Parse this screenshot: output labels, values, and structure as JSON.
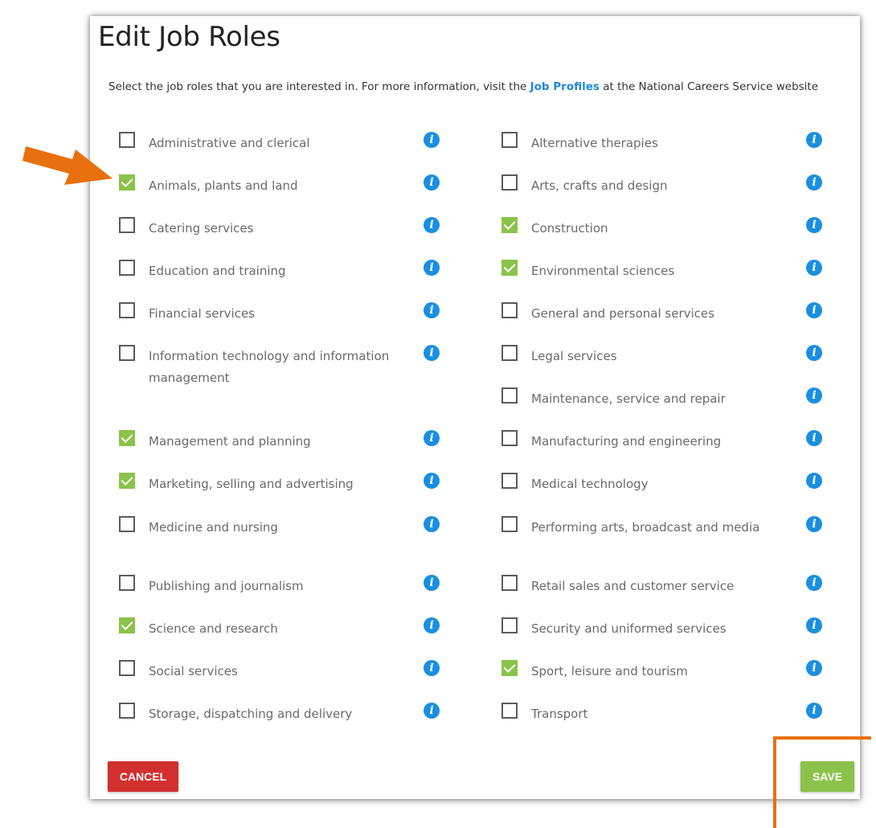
{
  "dialog": {
    "title": "Edit Job Roles",
    "intro_before": "Select the job roles that you are interested in. For more information, visit the ",
    "intro_link": "Job Profiles",
    "intro_after": " at the National Careers Service website"
  },
  "left_column": [
    {
      "label": "Administrative and clerical",
      "checked": false
    },
    {
      "label": "Animals, plants and land",
      "checked": true
    },
    {
      "label": "Catering services",
      "checked": false
    },
    {
      "label": "Education and training",
      "checked": false
    },
    {
      "label": "Financial services",
      "checked": false
    },
    {
      "label": "Information technology and information management",
      "checked": false
    },
    {
      "label": "Management and planning",
      "checked": true
    },
    {
      "label": "Marketing, selling and advertising",
      "checked": true
    },
    {
      "label": "Medicine and nursing",
      "checked": false
    },
    {
      "label": "Publishing and journalism",
      "checked": false
    },
    {
      "label": "Science and research",
      "checked": true
    },
    {
      "label": "Social services",
      "checked": false
    },
    {
      "label": "Storage, dispatching and delivery",
      "checked": false
    }
  ],
  "right_column": [
    {
      "label": "Alternative therapies",
      "checked": false
    },
    {
      "label": "Arts, crafts and design",
      "checked": false
    },
    {
      "label": "Construction",
      "checked": true
    },
    {
      "label": "Environmental sciences",
      "checked": true
    },
    {
      "label": "General and personal services",
      "checked": false
    },
    {
      "label": "Legal services",
      "checked": false
    },
    {
      "label": "Maintenance, service and repair",
      "checked": false
    },
    {
      "label": "Manufacturing and engineering",
      "checked": false
    },
    {
      "label": "Medical technology",
      "checked": false
    },
    {
      "label": "Performing arts, broadcast and media",
      "checked": false
    },
    {
      "label": "Retail sales and customer service",
      "checked": false
    },
    {
      "label": "Security and uniformed services",
      "checked": false
    },
    {
      "label": "Sport, leisure and tourism",
      "checked": true
    },
    {
      "label": "Transport",
      "checked": false
    }
  ],
  "buttons": {
    "cancel": "CANCEL",
    "save": "SAVE"
  },
  "icons": {
    "info": "info-icon",
    "checkbox_checked": "checkmark-icon",
    "annotation": "arrow-icon"
  },
  "colors": {
    "checked": "#8bc34a",
    "info": "#1a8fe0",
    "cancel": "#d32f2f",
    "save": "#8bc34a",
    "annotation": "#e8700f",
    "link": "#1e88d4"
  }
}
